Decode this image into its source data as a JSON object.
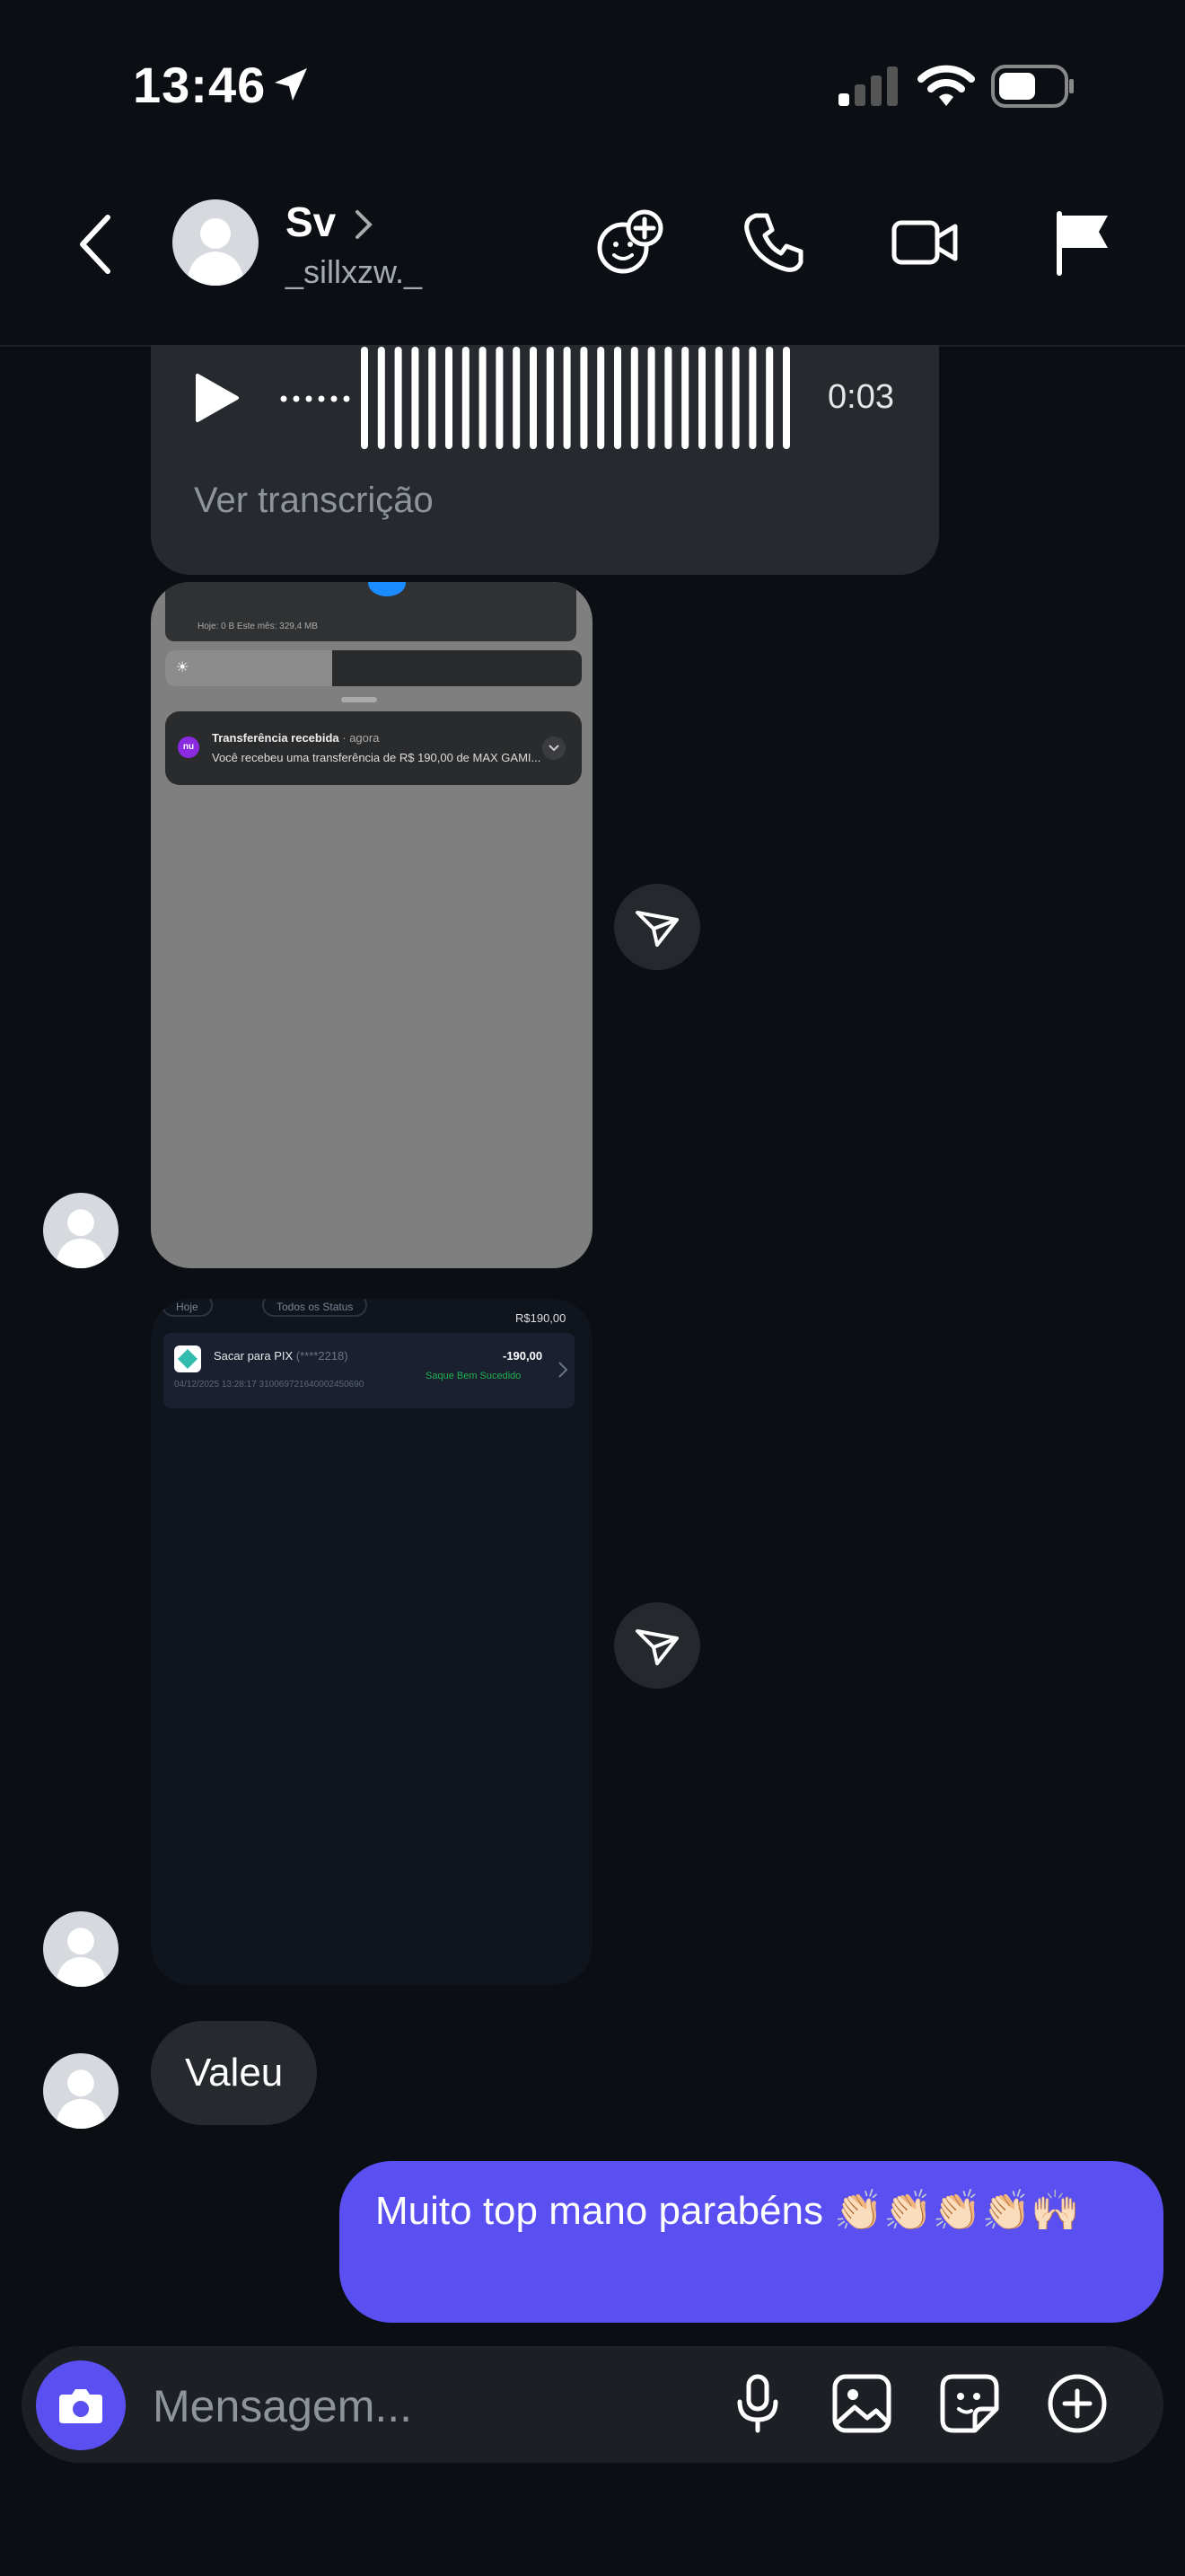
{
  "status_bar": {
    "time": "13:46"
  },
  "header": {
    "name": "Sv",
    "username": "_sillxzw._"
  },
  "messages": {
    "voice": {
      "duration": "0:03",
      "transcript_label": "Ver transcrição"
    },
    "image1": {
      "storage_text": "Hoje: 0 B    Este mês: 329,4 MB",
      "notification_title": "Transferência recebida",
      "notification_time": "· agora",
      "notification_body": "Você recebeu uma transferência de R$ 190,00 de MAX GAMI...",
      "app_badge": "nu"
    },
    "image2": {
      "filter1": "Hoje",
      "filter2": "Todos os Status",
      "balance": "R$190,00",
      "tx_title": "Sacar para PIX",
      "tx_masked": "(****2218)",
      "tx_meta": "04/12/2025 13:28:17  310069721640002450690",
      "tx_value": "-190,00",
      "tx_status": "Saque Bem Sucedido"
    },
    "incoming_text": "Valeu",
    "outgoing_text": "Muito top mano parabéns 👏🏻👏🏻👏🏻👏🏻🙌🏻"
  },
  "composer": {
    "placeholder": "Mensagem..."
  },
  "colors": {
    "accent": "#5a4ff0",
    "background": "#0b0f13",
    "bubble_incoming": "#26292e",
    "success": "#22b14c"
  }
}
